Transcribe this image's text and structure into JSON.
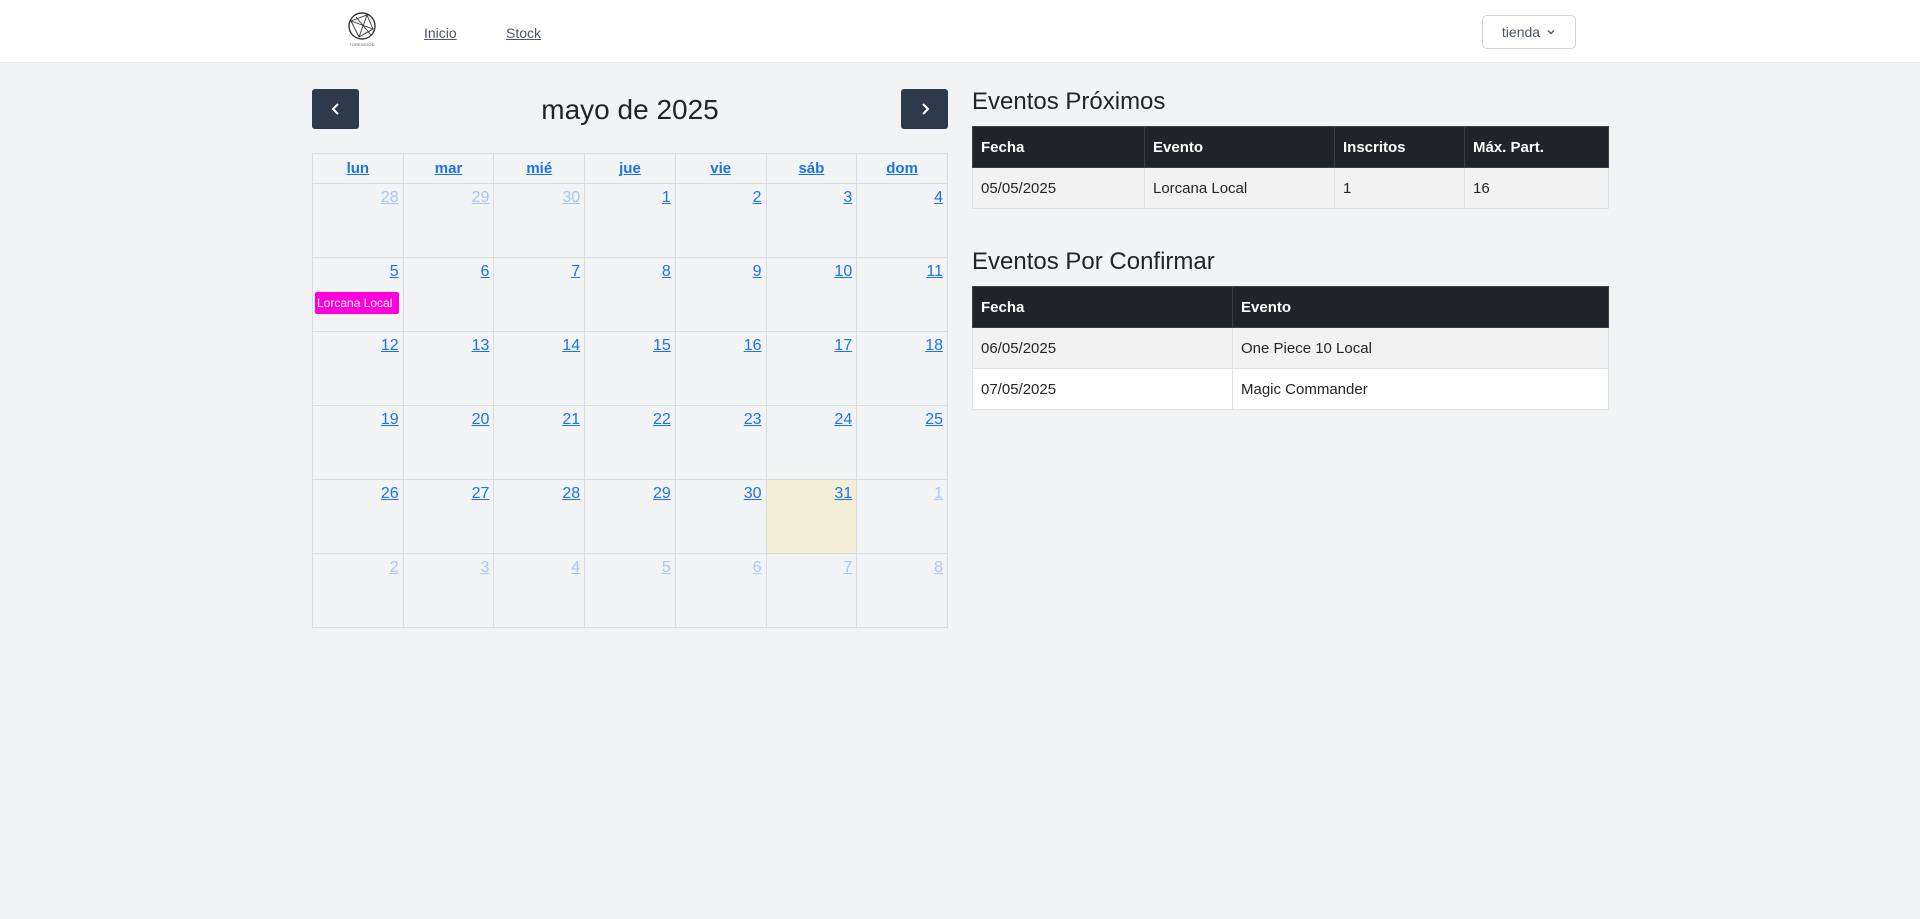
{
  "navbar": {
    "logo_text": "TOREWOOD",
    "links": [
      "Inicio",
      "Stock"
    ],
    "store_dropdown": "tienda",
    "logo_icon": "globe-network-icon",
    "dropdown_icon": "chevron-down-icon"
  },
  "calendar": {
    "title": "mayo de 2025",
    "prev_icon": "chevron-left-icon",
    "next_icon": "chevron-right-icon",
    "weekdays": [
      "lun",
      "mar",
      "mié",
      "jue",
      "vie",
      "sáb",
      "dom"
    ],
    "weeks": [
      [
        {
          "day": "28",
          "other": true
        },
        {
          "day": "29",
          "other": true
        },
        {
          "day": "30",
          "other": true
        },
        {
          "day": "1"
        },
        {
          "day": "2"
        },
        {
          "day": "3"
        },
        {
          "day": "4"
        }
      ],
      [
        {
          "day": "5",
          "event": "Lorcana Local"
        },
        {
          "day": "6"
        },
        {
          "day": "7"
        },
        {
          "day": "8"
        },
        {
          "day": "9"
        },
        {
          "day": "10"
        },
        {
          "day": "11"
        }
      ],
      [
        {
          "day": "12"
        },
        {
          "day": "13"
        },
        {
          "day": "14"
        },
        {
          "day": "15"
        },
        {
          "day": "16"
        },
        {
          "day": "17"
        },
        {
          "day": "18"
        }
      ],
      [
        {
          "day": "19"
        },
        {
          "day": "20"
        },
        {
          "day": "21"
        },
        {
          "day": "22"
        },
        {
          "day": "23"
        },
        {
          "day": "24"
        },
        {
          "day": "25"
        }
      ],
      [
        {
          "day": "26"
        },
        {
          "day": "27"
        },
        {
          "day": "28"
        },
        {
          "day": "29"
        },
        {
          "day": "30"
        },
        {
          "day": "31",
          "today": true
        },
        {
          "day": "1",
          "other": true
        }
      ],
      [
        {
          "day": "2",
          "other": true
        },
        {
          "day": "3",
          "other": true
        },
        {
          "day": "4",
          "other": true
        },
        {
          "day": "5",
          "other": true
        },
        {
          "day": "6",
          "other": true
        },
        {
          "day": "7",
          "other": true
        },
        {
          "day": "8",
          "other": true
        }
      ]
    ],
    "event_color": "#ff00dd",
    "today_color": "#f2efd6"
  },
  "upcoming": {
    "title": "Eventos Próximos",
    "headers": [
      "Fecha",
      "Evento",
      "Inscritos",
      "Máx. Part."
    ],
    "rows": [
      [
        "05/05/2025",
        "Lorcana Local",
        "1",
        "16"
      ]
    ]
  },
  "pending": {
    "title": "Eventos Por Confirmar",
    "headers": [
      "Fecha",
      "Evento"
    ],
    "rows": [
      [
        "06/05/2025",
        "One Piece 10 Local"
      ],
      [
        "07/05/2025",
        "Magic Commander"
      ]
    ]
  }
}
